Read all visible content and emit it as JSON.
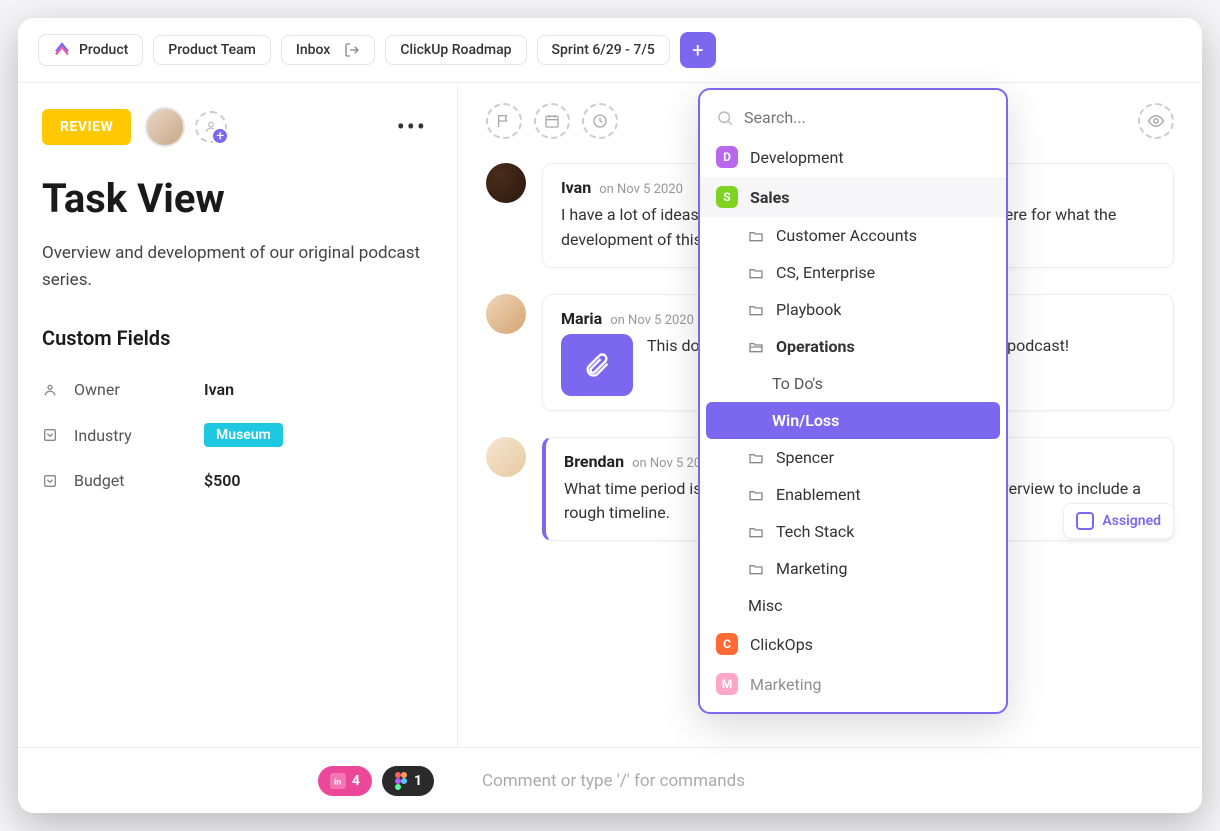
{
  "breadcrumb": {
    "product": "Product",
    "team": "Product Team",
    "inbox": "Inbox",
    "roadmap": "ClickUp Roadmap",
    "sprint": "Sprint 6/29 - 7/5"
  },
  "task": {
    "status": "REVIEW",
    "title": "Task View",
    "description": "Overview and development of our original podcast series.",
    "custom_fields_heading": "Custom Fields",
    "fields": {
      "owner_label": "Owner",
      "owner_value": "Ivan",
      "industry_label": "Industry",
      "industry_value": "Museum",
      "budget_label": "Budget",
      "budget_value": "$500"
    }
  },
  "comments": [
    {
      "name": "Ivan",
      "date": "on Nov 5 2020",
      "body": "I have a lot of ideas on this, it'd be great to brainstorm somewhere for what the development of this would look like."
    },
    {
      "name": "Maria",
      "date": "on Nov 5 2020",
      "body": "This doc is where I'm keeping thoughts on the first podcast!"
    },
    {
      "name": "Brendan",
      "date": "on Nov 5 2020",
      "body": "What time period is this set to launch? Would love to update overview to include a rough timeline."
    }
  ],
  "dropdown": {
    "search_placeholder": "Search...",
    "spaces": {
      "development": "Development",
      "sales": "Sales",
      "clickops": "ClickOps",
      "marketing": "Marketing"
    },
    "sales_folders": {
      "customer_accounts": "Customer Accounts",
      "cs_enterprise": "CS, Enterprise",
      "playbook": "Playbook",
      "operations": "Operations",
      "spencer": "Spencer",
      "enablement": "Enablement",
      "tech_stack": "Tech Stack",
      "marketing": "Marketing",
      "misc": "Misc"
    },
    "operations_items": {
      "todos": "To Do's",
      "winloss": "Win/Loss"
    }
  },
  "assigned_label": "Assigned",
  "footer": {
    "invision_count": "4",
    "figma_count": "1",
    "comment_placeholder": "Comment or type '/' for commands"
  }
}
